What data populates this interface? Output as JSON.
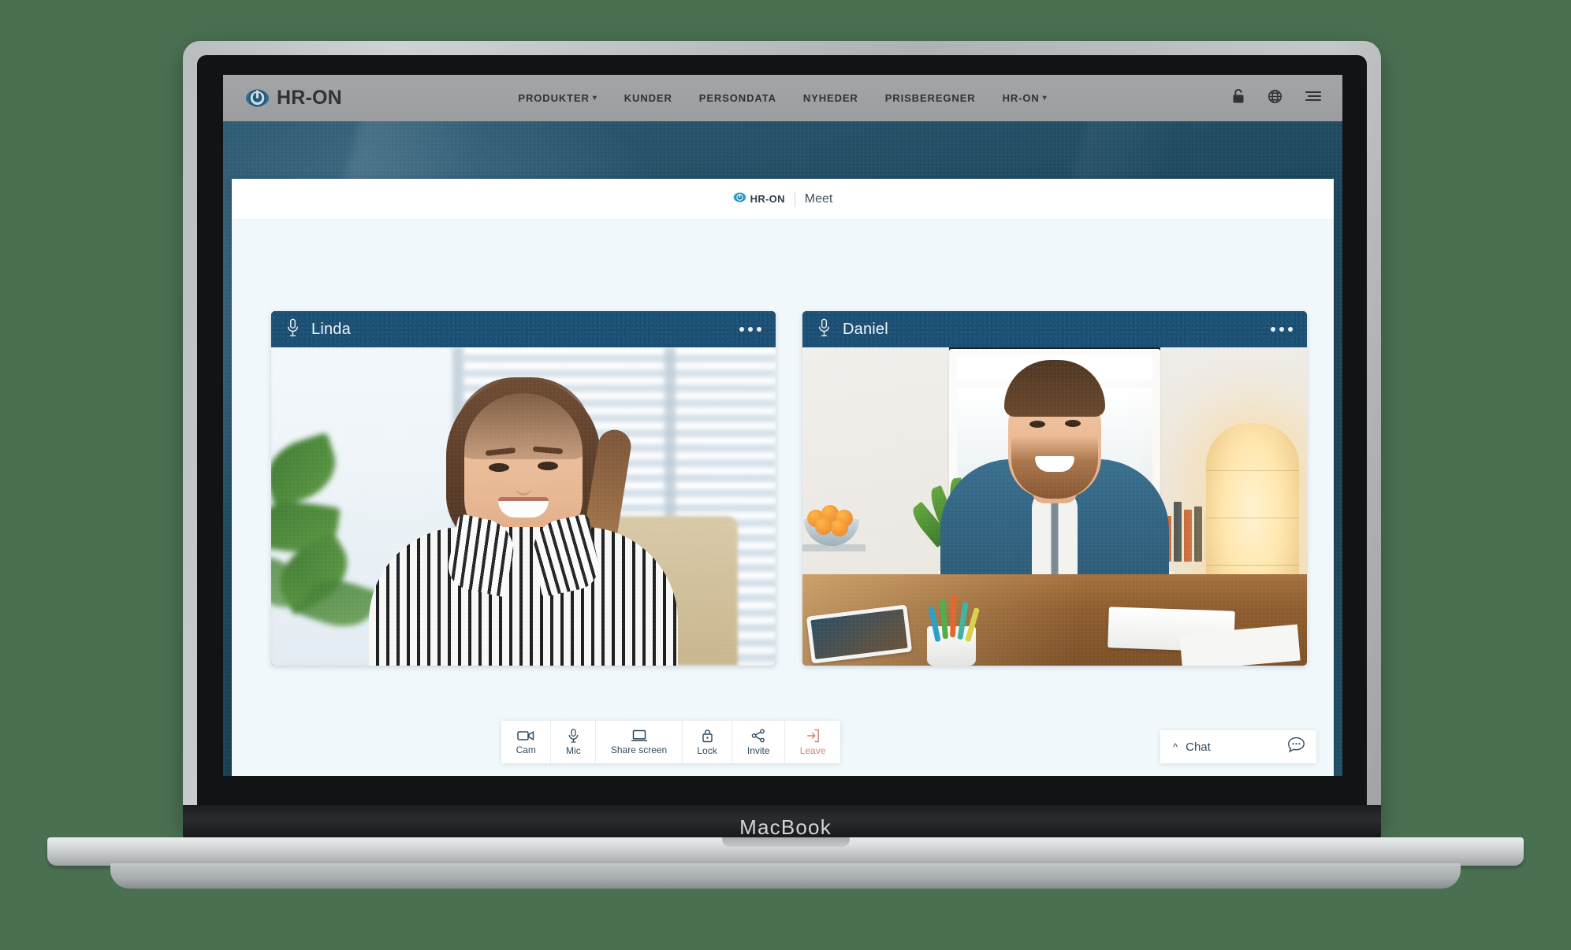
{
  "device": {
    "wordmark": "MacBook"
  },
  "site_header": {
    "logo_text": "HR-ON",
    "logo_icon": "hr-on-eye-logo-icon",
    "nav": [
      {
        "label": "PRODUKTER",
        "has_chevron": true
      },
      {
        "label": "KUNDER",
        "has_chevron": false
      },
      {
        "label": "PERSONDATA",
        "has_chevron": false
      },
      {
        "label": "NYHEDER",
        "has_chevron": false
      },
      {
        "label": "PRISBEREGNER",
        "has_chevron": false
      },
      {
        "label": "HR-ON",
        "has_chevron": true
      }
    ],
    "icons": [
      {
        "name": "lock-icon"
      },
      {
        "name": "globe-icon"
      },
      {
        "name": "hamburger-menu-icon"
      }
    ]
  },
  "meet_app": {
    "topbar": {
      "brand": "HR-ON",
      "brand_icon": "hr-on-eye-logo-icon",
      "title": "Meet"
    },
    "participants": [
      {
        "name": "Linda",
        "mic_icon": "microphone-icon",
        "menu_icon": "more-options-icon",
        "video_scene": "woman-in-striped-shirt-bright-office"
      },
      {
        "name": "Daniel",
        "mic_icon": "microphone-icon",
        "menu_icon": "more-options-icon",
        "video_scene": "man-in-blue-shirt-home-office-desk"
      }
    ],
    "controls": [
      {
        "label": "Cam",
        "icon": "camera-icon",
        "accent": false
      },
      {
        "label": "Mic",
        "icon": "microphone-icon",
        "accent": false
      },
      {
        "label": "Share screen",
        "icon": "laptop-screen-icon",
        "accent": false
      },
      {
        "label": "Lock",
        "icon": "lock-icon",
        "accent": false
      },
      {
        "label": "Invite",
        "icon": "share-nodes-icon",
        "accent": false
      },
      {
        "label": "Leave",
        "icon": "exit-arrow-icon",
        "accent": true
      }
    ],
    "chat": {
      "label": "Chat",
      "chevron_icon": "chevron-up-icon",
      "bubble_icon": "chat-bubble-icon"
    }
  },
  "colors": {
    "page_background": "#4a7052",
    "header_gray": "#a3a5a6",
    "hero_teal": "#1f4a60",
    "tile_header_navy": "#1a4f73",
    "stage_background": "#f1f8fb",
    "brand_blue": "#2d4a5c",
    "leave_accent": "#d4836f",
    "logo_cyan": "#1f9ac4"
  }
}
